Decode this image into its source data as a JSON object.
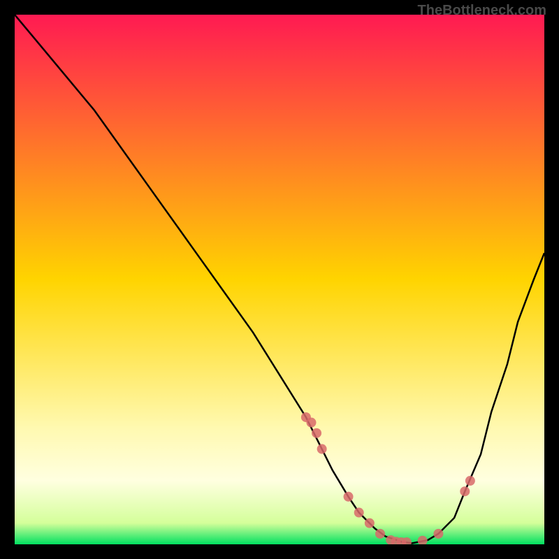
{
  "watermark": "TheBottleneck.com",
  "chart_data": {
    "type": "line",
    "title": "",
    "xlabel": "",
    "ylabel": "",
    "xlim": [
      0,
      100
    ],
    "ylim": [
      0,
      100
    ],
    "gradient_stops": [
      {
        "offset": 0,
        "color": "#ff1a52"
      },
      {
        "offset": 50,
        "color": "#ffd400"
      },
      {
        "offset": 78,
        "color": "#fff9b0"
      },
      {
        "offset": 88,
        "color": "#ffffe0"
      },
      {
        "offset": 96,
        "color": "#d4ff9a"
      },
      {
        "offset": 100,
        "color": "#00e060"
      }
    ],
    "curve": {
      "x": [
        0,
        5,
        10,
        15,
        20,
        25,
        30,
        35,
        40,
        45,
        50,
        55,
        58,
        60,
        63,
        65,
        68,
        70,
        73,
        75,
        78,
        80,
        83,
        85,
        88,
        90,
        93,
        95,
        98,
        100
      ],
      "y": [
        100,
        94,
        88,
        82,
        75,
        68,
        61,
        54,
        47,
        40,
        32,
        24,
        18,
        14,
        9,
        6,
        3,
        1.5,
        0.5,
        0.2,
        0.8,
        2,
        5,
        10,
        17,
        25,
        34,
        42,
        50,
        55
      ]
    },
    "markers": {
      "x": [
        55,
        56,
        57,
        58,
        63,
        65,
        67,
        69,
        71,
        72,
        73,
        74,
        77,
        80,
        85,
        86
      ],
      "y": [
        24,
        23,
        21,
        18,
        9,
        6,
        4,
        2,
        0.8,
        0.5,
        0.4,
        0.4,
        0.7,
        2,
        10,
        12
      ],
      "color": "#d86a6a",
      "radius": 7
    }
  }
}
